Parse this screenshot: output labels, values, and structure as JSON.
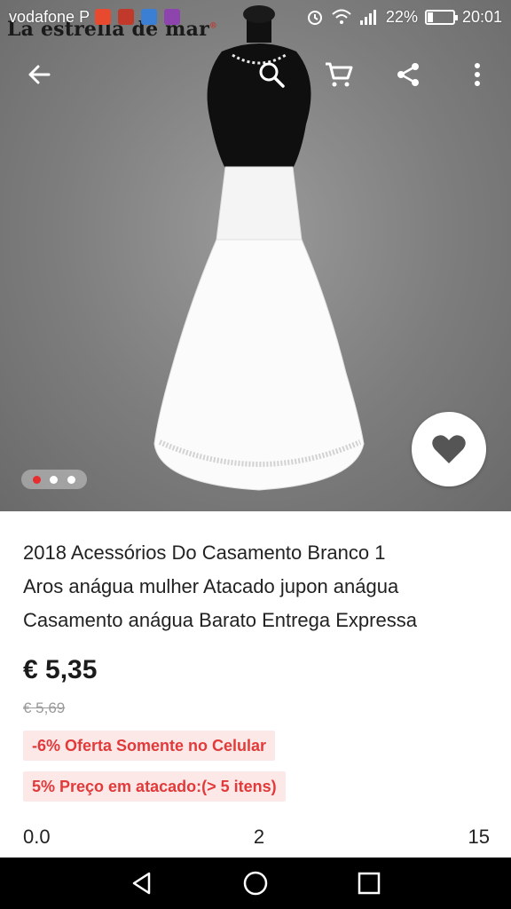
{
  "status_bar": {
    "carrier": "vodafone P",
    "battery_percent": "22%",
    "battery_level": 0.22,
    "time": "20:01",
    "notification_icons": [
      "mail-icon",
      "red-app-icon",
      "wifi-settings-icon",
      "gallery-icon"
    ]
  },
  "watermark": {
    "text": "La estrella de mar",
    "mark": "®"
  },
  "toolbar": {
    "back_icon": "arrow-left-icon",
    "search_icon": "search-icon",
    "cart_icon": "cart-icon",
    "share_icon": "share-icon",
    "more_icon": "more-vertical-icon"
  },
  "carousel": {
    "count": 3,
    "active_index": 0,
    "active_color": "#e62e2e"
  },
  "favorite": {
    "icon": "heart-icon"
  },
  "product": {
    "title_line1": "2018 Acessórios Do Casamento Branco 1",
    "title_line2": "Aros anágua mulher Atacado jupon anágua",
    "title_line3": "Casamento anágua Barato Entrega Expressa",
    "price": "€ 5,35",
    "old_price": "€ 5,69",
    "promo_mobile": "-6% Oferta Somente no Celular",
    "promo_wholesale": "5% Preço em atacado:(> 5 itens)",
    "stat_rating": "0.0",
    "stat_reviews": "2",
    "stat_orders": "15"
  },
  "colors": {
    "accent": "#e23a3a",
    "promo_bg": "#fde8e8"
  },
  "nav_bar": {
    "back": "nav-back-icon",
    "home": "nav-home-icon",
    "recents": "nav-recents-icon"
  }
}
